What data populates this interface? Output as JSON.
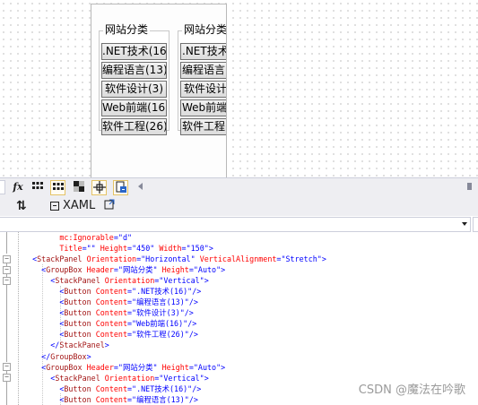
{
  "designer": {
    "groups": [
      {
        "header": "网站分类",
        "buttons": [
          ".NET技术(16)",
          "编程语言(13)",
          "软件设计(3)",
          "Web前端(16)",
          "软件工程(26)"
        ]
      },
      {
        "header": "网站分类",
        "buttons": [
          ".NET技术",
          "编程语言",
          "软件设计",
          "Web前端",
          "软件工程"
        ]
      }
    ]
  },
  "toolbar": {
    "fx_label": "fx",
    "icons": [
      "grid-icon",
      "snap-grid-icon",
      "artboard-background-icon",
      "snap-lines-icon",
      "project-code-icon"
    ]
  },
  "tabs": {
    "swap_label": "⇅",
    "xaml_label": "XAML",
    "xaml_icon": "xaml-icon",
    "popout_icon": "popout-icon"
  },
  "code_lines": [
    "        mc:Ignorable=\"d\"",
    "        Title=\"\" Height=\"450\" Width=\"150\">",
    "  <StackPanel Orientation=\"Horizontal\" VerticalAlignment=\"Stretch\">",
    "    <GroupBox Header=\"网站分类\" Height=\"Auto\">",
    "      <StackPanel Orientation=\"Vertical\">",
    "        <Button Content=\".NET技术(16)\"/>",
    "        <Button Content=\"编程语言(13)\"/>",
    "        <Button Content=\"软件设计(3)\"/>",
    "        <Button Content=\"Web前端(16)\"/>",
    "        <Button Content=\"软件工程(26)\"/>",
    "      </StackPanel>",
    "    </GroupBox>",
    "    <GroupBox Header=\"网站分类\" Height=\"Auto\">",
    "      <StackPanel Orientation=\"Vertical\">",
    "        <Button Content=\".NET技术(16)\"/>",
    "        <Button Content=\"编程语言(13)\"/>"
  ],
  "watermark": "CSDN @魔法在吟歌",
  "colors": {
    "tag": "#a31515",
    "attribute": "#ff0000",
    "value": "#0000ff",
    "selection": "#e5c365"
  }
}
